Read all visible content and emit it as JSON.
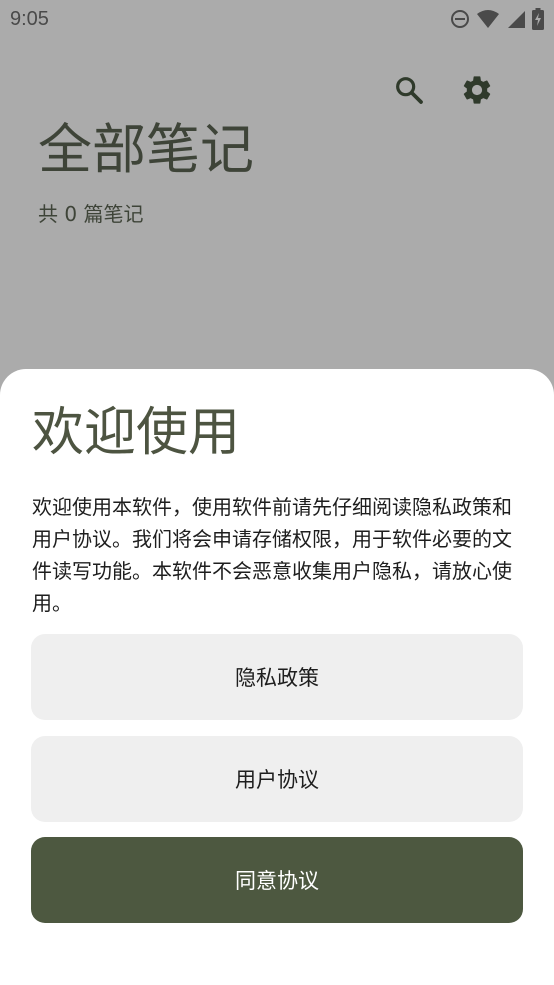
{
  "status_bar": {
    "time": "9:05",
    "icons": [
      "dnd-icon",
      "wifi-icon",
      "signal-icon",
      "battery-charging-icon"
    ]
  },
  "toolbar": {
    "icons": [
      "search-icon",
      "settings-icon"
    ]
  },
  "page": {
    "title": "全部笔记",
    "count_text": "共 0 篇笔记"
  },
  "dialog": {
    "title": "欢迎使用",
    "body": "欢迎使用本软件，使用软件前请先仔细阅读隐私政策和用户协议。我们将会申请存储权限，用于软件必要的文件读写功能。本软件不会恶意收集用户隐私，请放心使用。",
    "privacy_button": "隐私政策",
    "agreement_button": "用户协议",
    "agree_button": "同意协议"
  },
  "colors": {
    "scrim": "#ababab",
    "accent": "#4d5840",
    "title_text": "#4d5441",
    "button_light": "#efefef"
  }
}
